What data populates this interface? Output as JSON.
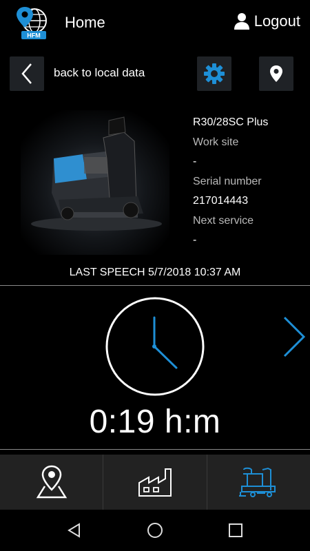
{
  "header": {
    "app_logo_text": "HFM",
    "title": "Home",
    "logout_label": "Logout"
  },
  "actions": {
    "back_label": "back to local data"
  },
  "machine": {
    "model": "R30/28SC Plus",
    "work_site_label": "Work site",
    "work_site_value": "-",
    "serial_label": "Serial number",
    "serial_value": "217014443",
    "next_service_label": "Next service",
    "next_service_value": "-"
  },
  "status": {
    "last_speech": "LAST SPEECH 5/7/2018 10:37 AM",
    "hours": "0:19 h:m"
  },
  "colors": {
    "accent": "#1e8fd6",
    "background": "#000000",
    "tabbar": "#222222"
  },
  "icons": {
    "back": "chevron-left-icon",
    "settings": "gear-icon",
    "location": "map-pin-icon",
    "clock": "clock-icon",
    "next": "chevron-right-icon",
    "tab_map": "map-location-icon",
    "tab_factory": "factory-icon",
    "tab_machine": "scrubber-machine-icon"
  }
}
